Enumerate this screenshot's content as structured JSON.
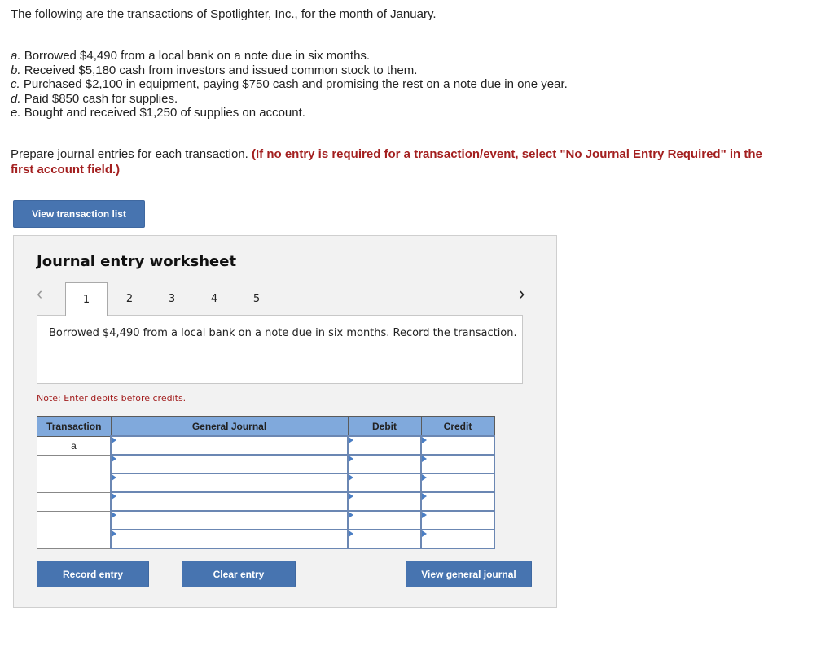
{
  "intro": "The following are the transactions of Spotlighter, Inc., for the month of January.",
  "transactions": [
    {
      "letter": "a.",
      "text": "Borrowed $4,490 from a local bank on a note due in six months."
    },
    {
      "letter": "b.",
      "text": "Received $5,180 cash from investors and issued common stock to them."
    },
    {
      "letter": "c.",
      "text": "Purchased $2,100 in equipment, paying $750 cash and promising the rest on a note due in one year."
    },
    {
      "letter": "d.",
      "text": "Paid $850 cash for supplies."
    },
    {
      "letter": "e.",
      "text": "Bought and received $1,250 of supplies on account."
    }
  ],
  "instructions": {
    "plain": "Prepare journal entries for each transaction. ",
    "emphasis": "(If no entry is required for a transaction/event, select \"No Journal Entry Required\" in the first account field.)"
  },
  "buttons": {
    "view_transaction_list": "View transaction list",
    "record_entry": "Record entry",
    "clear_entry": "Clear entry",
    "view_general_journal": "View general journal"
  },
  "worksheet": {
    "title": "Journal entry worksheet",
    "prev_icon": "‹",
    "next_icon": "›",
    "tabs": [
      "1",
      "2",
      "3",
      "4",
      "5"
    ],
    "active_tab": "1",
    "description": "Borrowed $4,490 from a local bank on a note due in six months. Record the transaction.",
    "note": "Note: Enter debits before credits."
  },
  "journal_table": {
    "headers": [
      "Transaction",
      "General Journal",
      "Debit",
      "Credit"
    ],
    "rows": [
      {
        "transaction": "a",
        "account": "",
        "debit": "",
        "credit": ""
      },
      {
        "transaction": "",
        "account": "",
        "debit": "",
        "credit": ""
      },
      {
        "transaction": "",
        "account": "",
        "debit": "",
        "credit": ""
      },
      {
        "transaction": "",
        "account": "",
        "debit": "",
        "credit": ""
      },
      {
        "transaction": "",
        "account": "",
        "debit": "",
        "credit": ""
      },
      {
        "transaction": "",
        "account": "",
        "debit": "",
        "credit": ""
      }
    ]
  },
  "colors": {
    "button": "#4774b0",
    "header": "#80a9dc",
    "emphasis": "#a31f1f"
  }
}
